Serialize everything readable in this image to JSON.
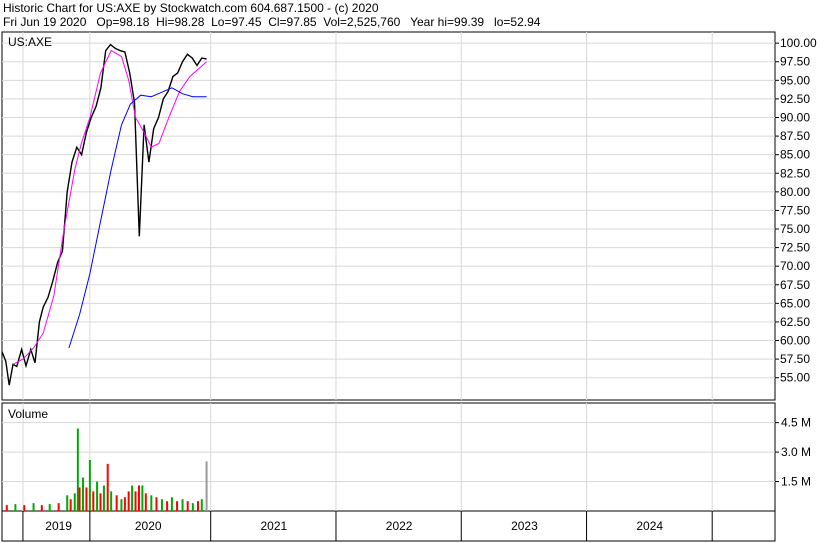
{
  "header": {
    "line1": "Historic Chart for US:AXE by Stockwatch.com 604.687.1500 - (c) 2020",
    "line2": "Fri Jun 19 2020   Op=98.18  Hi=98.28  Lo=97.45  Cl=97.85  Vol=2,525,760   Year hi=99.39   lo=52.94"
  },
  "chart_data": [
    {
      "type": "line",
      "name": "price",
      "panel_label": "US:AXE",
      "ylim": [
        52,
        101.5
      ],
      "yticks": [
        "100.00",
        "97.50",
        "95.00",
        "92.50",
        "90.00",
        "87.50",
        "85.00",
        "82.50",
        "80.00",
        "77.50",
        "75.00",
        "72.50",
        "70.00",
        "67.50",
        "65.00",
        "62.50",
        "60.00",
        "57.50",
        "55.00"
      ],
      "ytick_values": [
        100,
        97.5,
        95,
        92.5,
        90,
        87.5,
        85,
        82.5,
        80,
        77.5,
        75,
        72.5,
        70,
        67.5,
        65,
        62.5,
        60,
        57.5,
        55
      ],
      "xlim": [
        "2018-11-01",
        "2024-12-31"
      ],
      "year_labels": [
        "2019",
        "2020",
        "2021",
        "2022",
        "2023",
        "2024"
      ],
      "year_label_dates": [
        "2019-04-15",
        "2020-01-01",
        "2021-01-01",
        "2022-01-01",
        "2023-01-01",
        "2024-01-01"
      ],
      "year_divider_dates": [
        "2019-01-01",
        "2019-07-15",
        "2020-07-01",
        "2021-07-01",
        "2022-07-01",
        "2023-07-01",
        "2024-07-01"
      ],
      "gridlines": true,
      "colors": {
        "price": "#000000",
        "ma_short": "#ff00ff",
        "ma_long": "#0000ff"
      },
      "series": [
        {
          "key": "price",
          "points": [
            [
              "2018-11-01",
              58.5
            ],
            [
              "2018-11-12",
              57.2
            ],
            [
              "2018-11-22",
              54.0
            ],
            [
              "2018-12-03",
              56.8
            ],
            [
              "2018-12-14",
              56.5
            ],
            [
              "2018-12-28",
              58.8
            ],
            [
              "2019-01-10",
              56.6
            ],
            [
              "2019-01-24",
              58.8
            ],
            [
              "2019-02-05",
              57.0
            ],
            [
              "2019-02-18",
              62.5
            ],
            [
              "2019-03-01",
              64.5
            ],
            [
              "2019-03-15",
              65.8
            ],
            [
              "2019-03-29",
              68.0
            ],
            [
              "2019-04-12",
              70.5
            ],
            [
              "2019-04-26",
              72.0
            ],
            [
              "2019-05-10",
              80.0
            ],
            [
              "2019-05-24",
              84.0
            ],
            [
              "2019-06-07",
              86.0
            ],
            [
              "2019-06-21",
              85.0
            ],
            [
              "2019-07-05",
              88.0
            ],
            [
              "2019-07-19",
              90.0
            ],
            [
              "2019-08-02",
              91.5
            ],
            [
              "2019-08-16",
              94.0
            ],
            [
              "2019-08-30",
              99.0
            ],
            [
              "2019-09-13",
              99.8
            ],
            [
              "2019-09-27",
              99.3
            ],
            [
              "2019-10-11",
              99.0
            ],
            [
              "2019-10-25",
              98.8
            ],
            [
              "2019-11-08",
              96.0
            ],
            [
              "2019-11-22",
              92.0
            ],
            [
              "2019-12-06",
              74.0
            ],
            [
              "2019-12-20",
              89.0
            ],
            [
              "2020-01-03",
              84.0
            ],
            [
              "2020-01-17",
              88.5
            ],
            [
              "2020-01-31",
              90.0
            ],
            [
              "2020-02-14",
              92.5
            ],
            [
              "2020-02-28",
              93.5
            ],
            [
              "2020-03-13",
              95.5
            ],
            [
              "2020-03-27",
              96.0
            ],
            [
              "2020-04-10",
              97.5
            ],
            [
              "2020-04-24",
              98.5
            ],
            [
              "2020-05-08",
              98.0
            ],
            [
              "2020-05-22",
              97.0
            ],
            [
              "2020-06-05",
              98.0
            ],
            [
              "2020-06-19",
              97.85
            ]
          ]
        },
        {
          "key": "ma_short",
          "points": [
            [
              "2018-12-03",
              56.8
            ],
            [
              "2019-01-01",
              57.5
            ],
            [
              "2019-02-01",
              59.0
            ],
            [
              "2019-03-01",
              61.0
            ],
            [
              "2019-04-01",
              66.0
            ],
            [
              "2019-05-01",
              75.0
            ],
            [
              "2019-06-01",
              83.0
            ],
            [
              "2019-06-20",
              86.5
            ],
            [
              "2019-07-15",
              90.0
            ],
            [
              "2019-08-15",
              96.0
            ],
            [
              "2019-09-15",
              99.0
            ],
            [
              "2019-10-15",
              98.2
            ],
            [
              "2019-11-05",
              95.0
            ],
            [
              "2019-11-25",
              90.0
            ],
            [
              "2019-12-20",
              88.0
            ],
            [
              "2020-01-10",
              86.0
            ],
            [
              "2020-02-01",
              86.5
            ],
            [
              "2020-03-01",
              90.0
            ],
            [
              "2020-04-01",
              93.5
            ],
            [
              "2020-05-01",
              95.5
            ],
            [
              "2020-06-19",
              97.5
            ]
          ]
        },
        {
          "key": "ma_long",
          "points": [
            [
              "2019-05-15",
              59.0
            ],
            [
              "2019-06-15",
              63.5
            ],
            [
              "2019-07-15",
              69.0
            ],
            [
              "2019-08-15",
              76.0
            ],
            [
              "2019-09-15",
              83.0
            ],
            [
              "2019-10-15",
              89.0
            ],
            [
              "2019-11-10",
              91.8
            ],
            [
              "2019-12-10",
              93.0
            ],
            [
              "2020-01-10",
              92.8
            ],
            [
              "2020-02-10",
              93.4
            ],
            [
              "2020-03-10",
              94.0
            ],
            [
              "2020-04-10",
              93.2
            ],
            [
              "2020-05-10",
              92.8
            ],
            [
              "2020-06-19",
              92.8
            ]
          ]
        }
      ]
    },
    {
      "type": "bar",
      "name": "volume",
      "panel_label": "Volume",
      "ylim": [
        0,
        5.5
      ],
      "yticks": [
        "4.5 M",
        "3.0 M",
        "1.5 M"
      ],
      "ytick_values": [
        4.5,
        3.0,
        1.5
      ],
      "colors": {
        "up": "#00aa00",
        "down": "#ff0000",
        "last": "#9a9a9a"
      },
      "bars": [
        [
          "2018-11-15",
          0.3,
          "down"
        ],
        [
          "2018-12-10",
          0.35,
          "up"
        ],
        [
          "2019-01-05",
          0.3,
          "down"
        ],
        [
          "2019-02-01",
          0.4,
          "up"
        ],
        [
          "2019-02-25",
          0.3,
          "down"
        ],
        [
          "2019-03-20",
          0.35,
          "up"
        ],
        [
          "2019-04-15",
          0.4,
          "down"
        ],
        [
          "2019-05-10",
          0.8,
          "up"
        ],
        [
          "2019-05-20",
          0.6,
          "down"
        ],
        [
          "2019-06-01",
          0.9,
          "up"
        ],
        [
          "2019-06-10",
          4.2,
          "up"
        ],
        [
          "2019-06-15",
          1.2,
          "down"
        ],
        [
          "2019-06-25",
          1.7,
          "up"
        ],
        [
          "2019-07-05",
          1.2,
          "down"
        ],
        [
          "2019-07-15",
          2.6,
          "up"
        ],
        [
          "2019-07-25",
          1.0,
          "down"
        ],
        [
          "2019-08-05",
          1.5,
          "up"
        ],
        [
          "2019-08-15",
          0.9,
          "down"
        ],
        [
          "2019-08-25",
          1.3,
          "up"
        ],
        [
          "2019-09-05",
          2.4,
          "down"
        ],
        [
          "2019-09-15",
          1.0,
          "up"
        ],
        [
          "2019-10-01",
          0.8,
          "down"
        ],
        [
          "2019-10-15",
          0.6,
          "up"
        ],
        [
          "2019-10-25",
          0.7,
          "down"
        ],
        [
          "2019-11-05",
          1.0,
          "down"
        ],
        [
          "2019-11-15",
          1.3,
          "up"
        ],
        [
          "2019-11-25",
          1.0,
          "down"
        ],
        [
          "2019-12-05",
          1.3,
          "down"
        ],
        [
          "2019-12-15",
          1.3,
          "up"
        ],
        [
          "2019-12-25",
          0.9,
          "down"
        ],
        [
          "2020-01-10",
          0.8,
          "up"
        ],
        [
          "2020-01-25",
          0.7,
          "down"
        ],
        [
          "2020-02-10",
          0.6,
          "up"
        ],
        [
          "2020-02-25",
          0.5,
          "down"
        ],
        [
          "2020-03-10",
          0.7,
          "up"
        ],
        [
          "2020-03-25",
          0.5,
          "down"
        ],
        [
          "2020-04-10",
          0.6,
          "up"
        ],
        [
          "2020-04-25",
          0.5,
          "down"
        ],
        [
          "2020-05-10",
          0.4,
          "up"
        ],
        [
          "2020-05-25",
          0.5,
          "down"
        ],
        [
          "2020-06-05",
          0.6,
          "up"
        ],
        [
          "2020-06-19",
          2.52576,
          "last"
        ]
      ]
    }
  ]
}
